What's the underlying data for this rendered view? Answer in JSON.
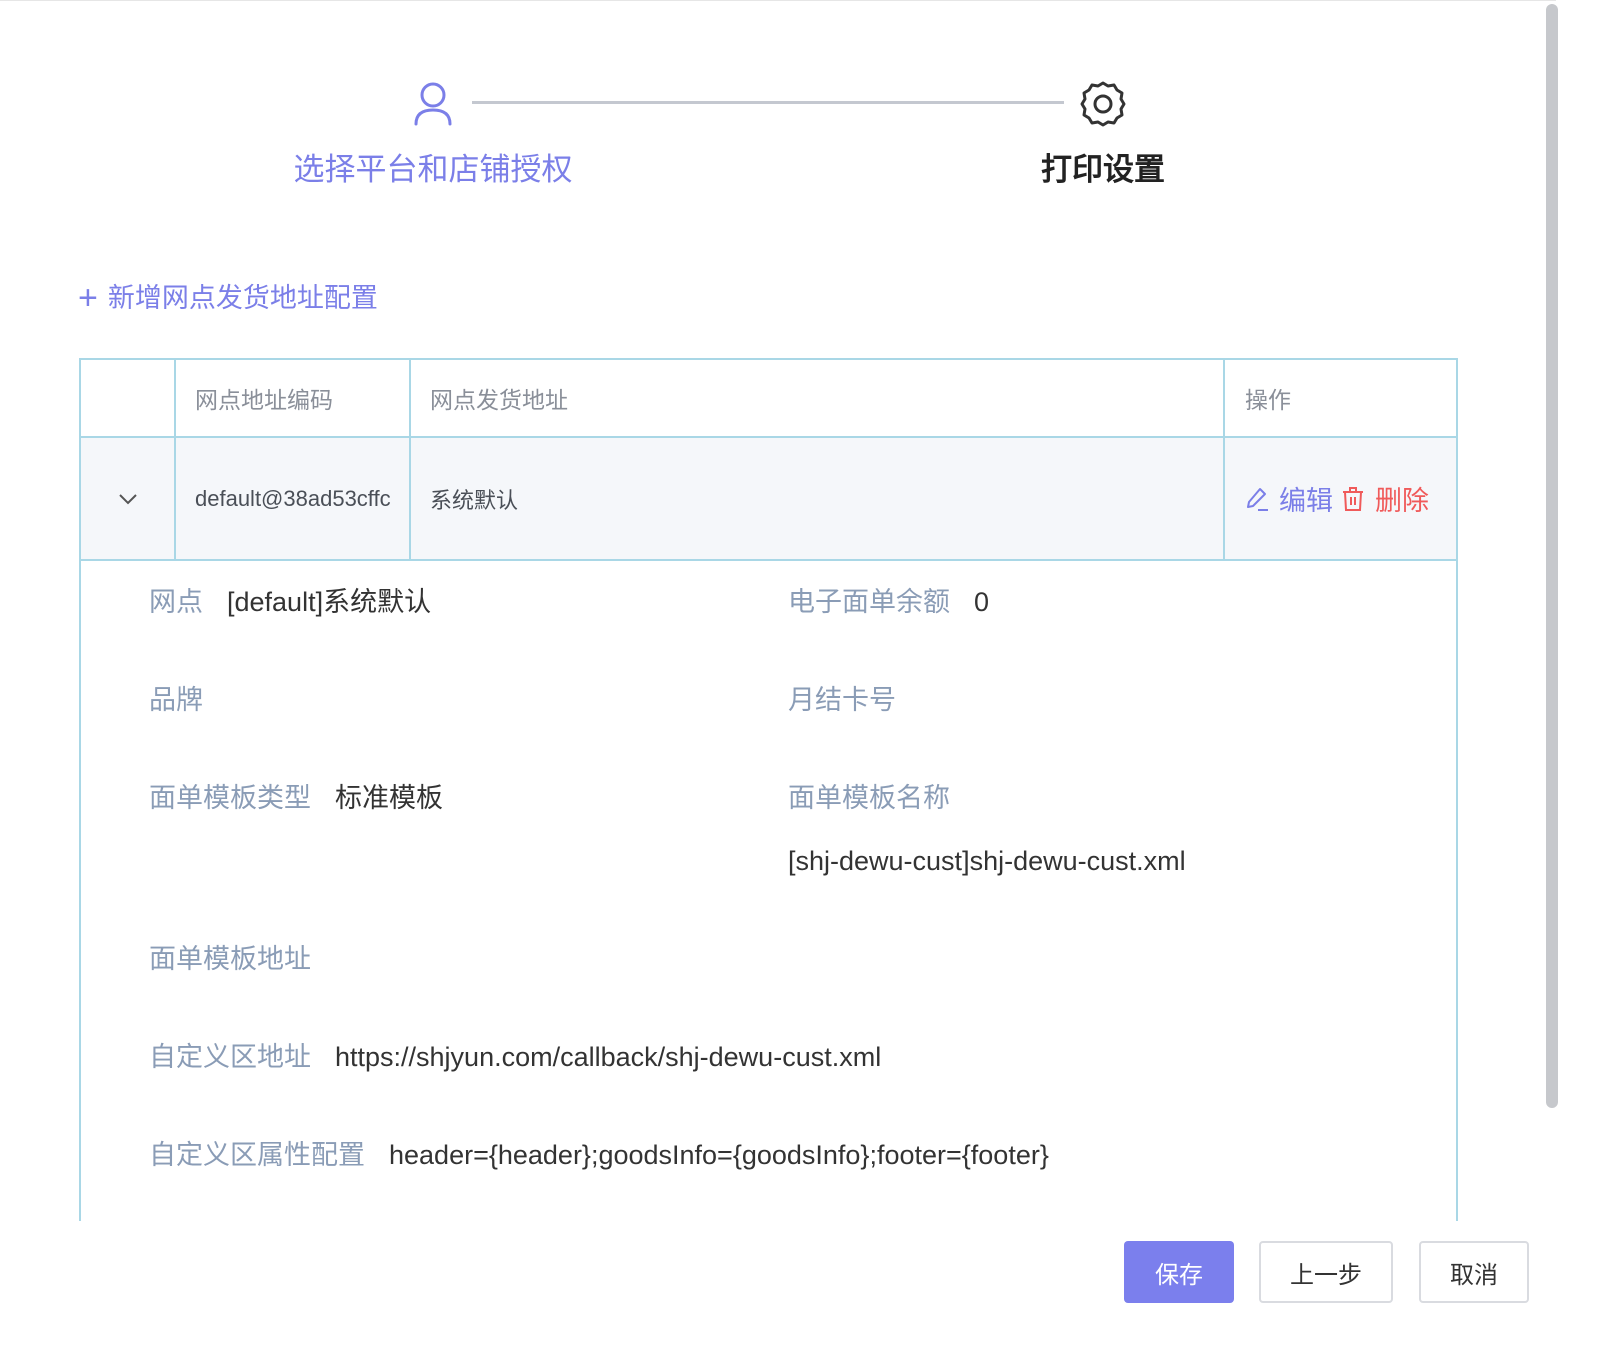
{
  "steps": [
    {
      "title": "选择平台和店铺授权",
      "icon": "user-icon",
      "state": "active"
    },
    {
      "title": "打印设置",
      "icon": "gear-icon",
      "state": "current"
    }
  ],
  "add_link": {
    "icon": "plus-icon",
    "label": "新增网点发货地址配置"
  },
  "table": {
    "columns": [
      "网点地址编码",
      "网点发货地址",
      "操作"
    ],
    "rows": [
      {
        "code": "default@38ad53cffc",
        "address": "系统默认",
        "expand_icon": "chevron-down-icon",
        "actions": {
          "edit": "编辑",
          "delete": "删除"
        }
      }
    ]
  },
  "details": {
    "branch": {
      "label": "网点",
      "value": "[default]系统默认"
    },
    "balance": {
      "label": "电子面单余额",
      "value": "0"
    },
    "brand": {
      "label": "品牌",
      "value": ""
    },
    "monthly_card": {
      "label": "月结卡号",
      "value": ""
    },
    "template_type": {
      "label": "面单模板类型",
      "value": "标准模板"
    },
    "template_name": {
      "label": "面单模板名称",
      "value": "[shj-dewu-cust]shj-dewu-cust.xml"
    },
    "template_url": {
      "label": "面单模板地址",
      "value": ""
    },
    "custom_url": {
      "label": "自定义区地址",
      "value": "https://shjyun.com/callback/shj-dewu-cust.xml"
    },
    "custom_props": {
      "label": "自定义区属性配置",
      "value": "header={header};goodsInfo={goodsInfo};footer={footer}"
    }
  },
  "footer": {
    "save": "保存",
    "prev": "上一步",
    "cancel": "取消"
  },
  "colors": {
    "accent": "#7b7fe8",
    "danger": "#f05a5a",
    "border": "#a9d7e6",
    "label": "#8a9cb6"
  }
}
